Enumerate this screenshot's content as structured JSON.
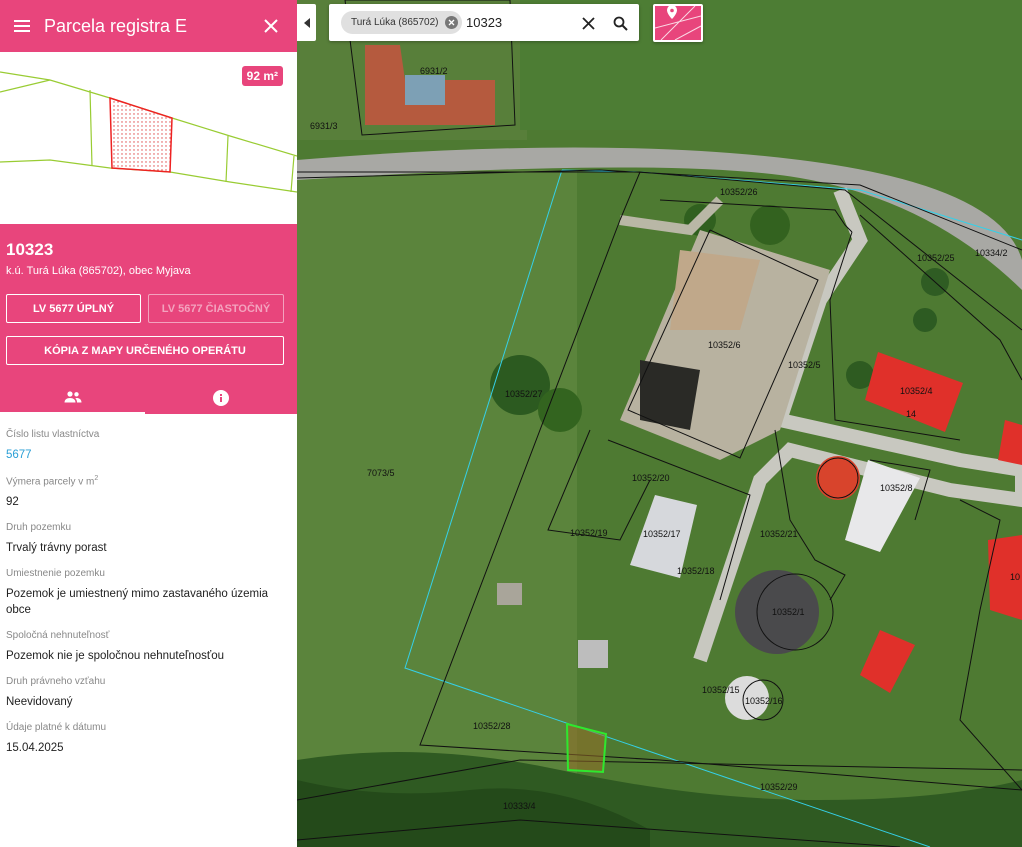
{
  "panel": {
    "title": "Parcela registra E",
    "area_badge": "92 m²",
    "parcel_number": "10323",
    "location": "k.ú. Turá Lúka (865702), obec Myjava",
    "buttons": {
      "full": "LV 5677 ÚPLNÝ",
      "partial": "LV 5677 ČIASTOČNÝ",
      "copy": "KÓPIA Z MAPY URČENÉHO OPERÁTU"
    },
    "tabs": {
      "owners_icon": "people-icon",
      "info_icon": "info-icon"
    },
    "fields": [
      {
        "label": "Číslo listu vlastníctva",
        "value": "5677"
      },
      {
        "label": "Výmera parcely v m²",
        "value": "92"
      },
      {
        "label": "Druh pozemku",
        "value": "Trvalý trávny porast"
      },
      {
        "label": "Umiestnenie pozemku",
        "value": "Pozemok je umiestnený mimo zastavaného územia obce"
      },
      {
        "label": "Spoločná nehnuteľnosť",
        "value": "Pozemok nie je spoločnou nehnuteľnosťou"
      },
      {
        "label": "Druh právneho vzťahu",
        "value": "Neevidovaný"
      },
      {
        "label": "Údaje platné k dátumu",
        "value": "15.04.2025"
      }
    ]
  },
  "search": {
    "chip": "Turá Lúka (865702)",
    "query": "10323"
  },
  "map_labels": {
    "l1": "6931/2",
    "l2": "6931/3",
    "l3": "10352/26",
    "l4": "10334/2",
    "l5": "10352/25",
    "l6": "10352/6",
    "l7": "10352/5",
    "l8": "10352/4",
    "l9": "14",
    "l10": "10352/27",
    "l11": "7073/5",
    "l12": "10352/20",
    "l13": "10352/8",
    "l14": "10352/19",
    "l15": "10352/17",
    "l16": "10352/21",
    "l17": "10352/18",
    "l18": "10352/1",
    "l19": "10352/15",
    "l20": "10352/16",
    "l21": "10352/28",
    "l22": "10352/29",
    "l23": "10333/4",
    "l24": "10"
  },
  "colors": {
    "accent": "#e8457c",
    "highlight": "#2ee82e",
    "link": "#2a9fd6"
  }
}
